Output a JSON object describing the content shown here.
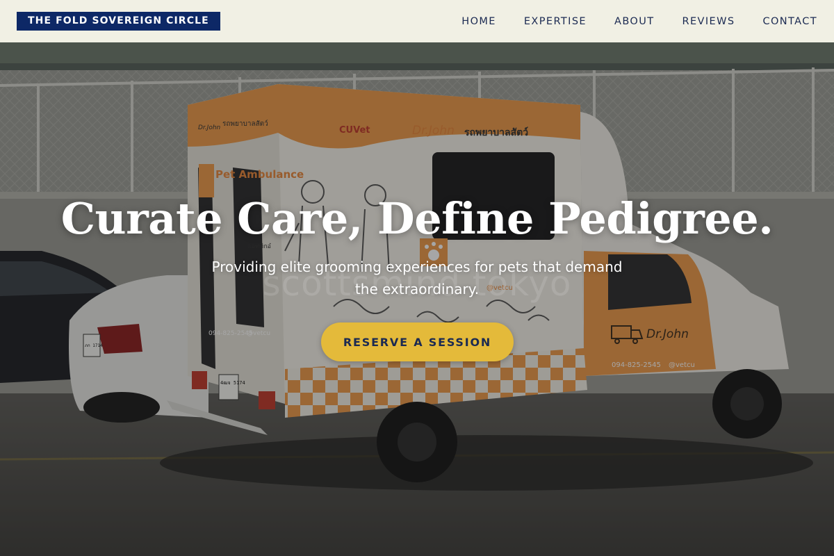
{
  "brand": {
    "name": "THE FOLD SOVEREIGN CIRCLE"
  },
  "nav": {
    "items": [
      {
        "label": "HOME"
      },
      {
        "label": "EXPERTISE"
      },
      {
        "label": "ABOUT"
      },
      {
        "label": "REVIEWS"
      },
      {
        "label": "CONTACT"
      }
    ]
  },
  "hero": {
    "title": "Curate Care, Define Pedigree.",
    "subtitle": "Providing elite grooming experiences for pets that demand the extraordinary.",
    "cta_label": "RESERVE A SESSION",
    "watermark": "scottsmind tokyo",
    "image_text": {
      "van_brand": "Dr.John",
      "van_service": "Pet Ambulance",
      "van_logo": "CUVet",
      "van_thai": "รถพยาบาลสัตว์",
      "van_phone": "094-825-2545",
      "van_handle": "@vetcu",
      "van_badge": "แอททิกอ๋",
      "plate": "4ฒจ 5174",
      "plate_car": "ภก 1714"
    }
  },
  "colors": {
    "navbar_bg": "#f1f0e4",
    "brand_bg": "#0d2866",
    "nav_text": "#1b2a52",
    "cta_bg": "#e4ba3a",
    "cta_text": "#1b2a52",
    "van_orange": "#ee9a4a"
  },
  "icons": [
    "paw-icon",
    "truck-icon",
    "phone-icon",
    "line-chat-icon",
    "cross-icon"
  ]
}
